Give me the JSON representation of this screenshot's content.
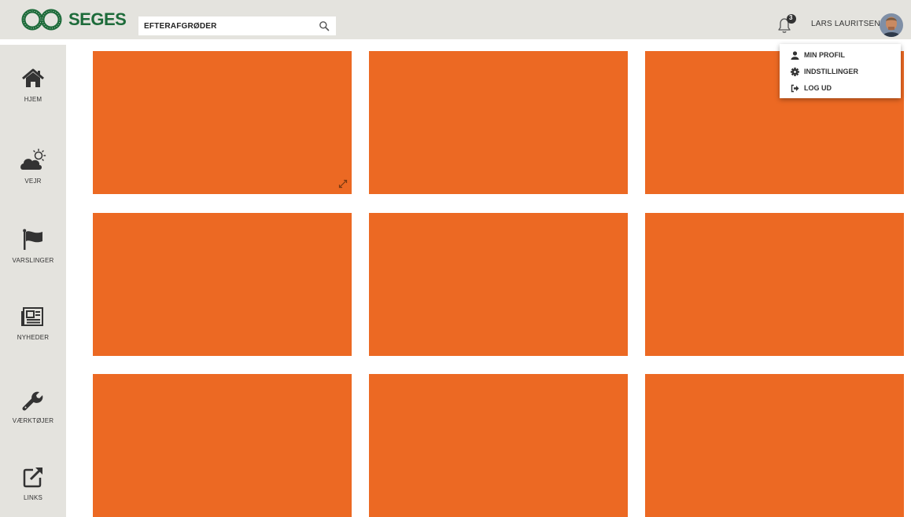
{
  "brand": {
    "logo_text": "SEGES",
    "primary_color": "#1d6b3a",
    "accent_color": "#ec6923"
  },
  "search": {
    "value": "EFTERAFGRØDER",
    "icon": "search-icon"
  },
  "notifications": {
    "count": "3",
    "icon": "bell-icon"
  },
  "user": {
    "name": "LARS LAURITSEN"
  },
  "user_menu": {
    "items": [
      {
        "label": "MIN PROFIL",
        "icon": "user-icon"
      },
      {
        "label": "INDSTILLINGER",
        "icon": "gear-icon"
      },
      {
        "label": "LOG UD",
        "icon": "logout-icon"
      }
    ]
  },
  "sidebar": {
    "items": [
      {
        "label": "HJEM",
        "icon": "home-icon"
      },
      {
        "label": "VEJR",
        "icon": "weather-icon"
      },
      {
        "label": "VARSLINGER",
        "icon": "flag-icon"
      },
      {
        "label": "NYHEDER",
        "icon": "newspaper-icon"
      },
      {
        "label": "VÆRKTØJER",
        "icon": "wrench-icon"
      },
      {
        "label": "LINKS",
        "icon": "external-link-icon"
      }
    ]
  },
  "tiles": {
    "count": 9,
    "expand_icon": "expand-icon"
  }
}
